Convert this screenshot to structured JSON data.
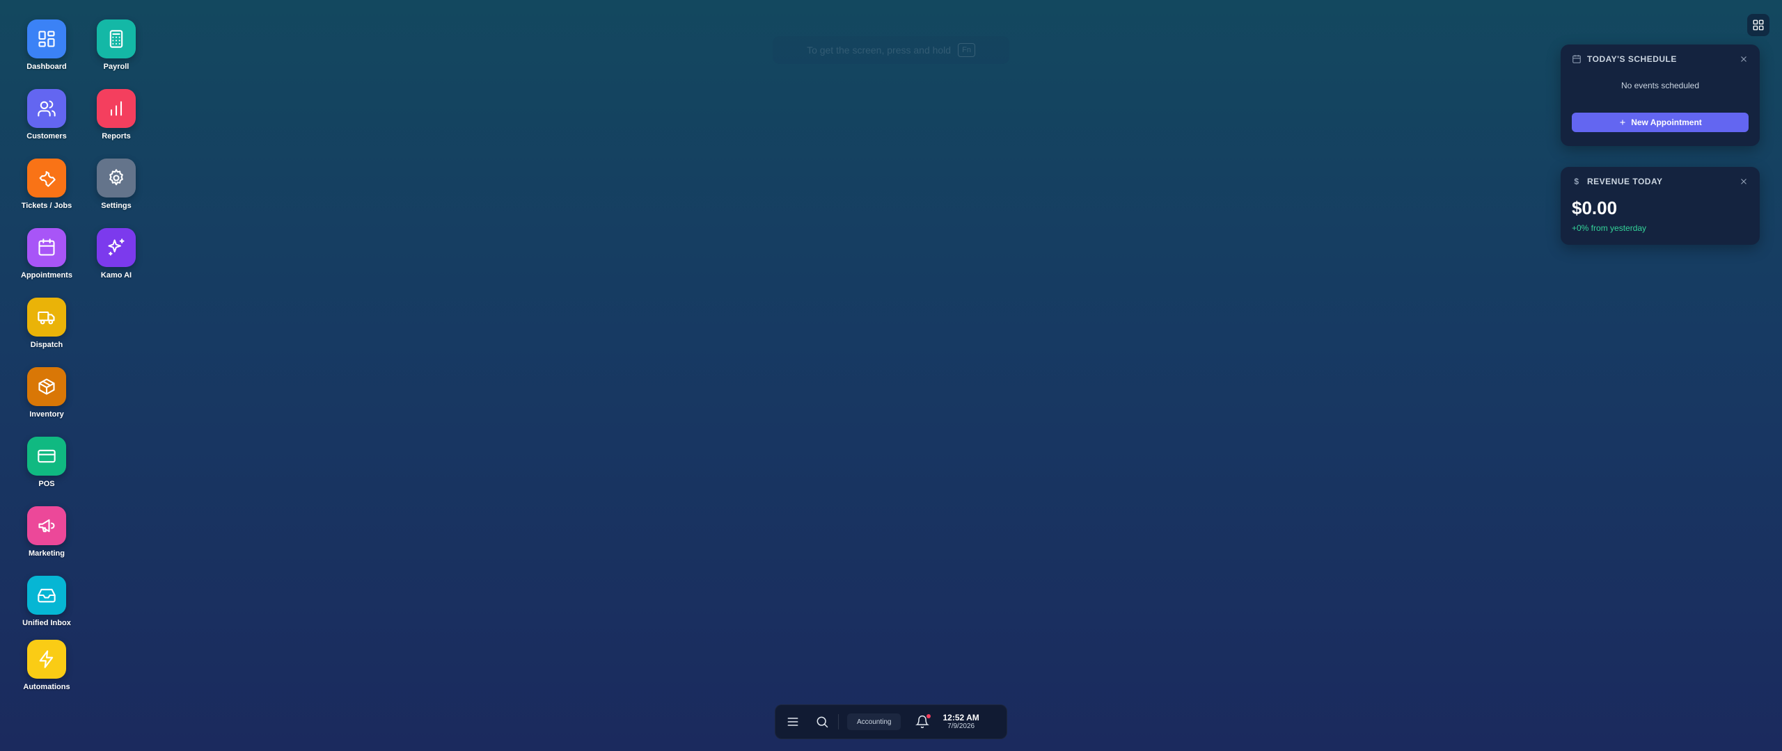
{
  "desktop": {
    "apps": [
      {
        "label": "Dashboard",
        "icon": "dashboard-icon",
        "color": "#3b82f6"
      },
      {
        "label": "Payroll",
        "icon": "calculator-icon",
        "color": "#14b8a6"
      },
      {
        "label": "Customers",
        "icon": "users-icon",
        "color": "#6366f1"
      },
      {
        "label": "Reports",
        "icon": "bar-chart-icon",
        "color": "#f43f5e"
      },
      {
        "label": "Tickets / Jobs",
        "icon": "wrench-icon",
        "color": "#f97316"
      },
      {
        "label": "Settings",
        "icon": "gear-icon",
        "color": "#64748b"
      },
      {
        "label": "Appointments",
        "icon": "calendar-icon",
        "color": "#a855f7"
      },
      {
        "label": "Kamo AI",
        "icon": "sparkles-icon",
        "color": "#7c3aed"
      },
      {
        "label": "Dispatch",
        "icon": "truck-icon",
        "color": "#eab308"
      },
      {
        "label": "Inventory",
        "icon": "box-icon",
        "color": "#d97706"
      },
      {
        "label": "POS",
        "icon": "credit-card-icon",
        "color": "#10b981"
      },
      {
        "label": "Marketing",
        "icon": "megaphone-icon",
        "color": "#ec4899"
      },
      {
        "label": "Unified Inbox",
        "icon": "inbox-icon",
        "color": "#06b6d4"
      },
      {
        "label": "Automations",
        "icon": "lightning-icon",
        "color": "#facc15"
      }
    ]
  },
  "hint": {
    "text": "To get the screen, press and hold",
    "key": "Fn"
  },
  "schedule_widget": {
    "title": "TODAY'S SCHEDULE",
    "empty_text": "No events scheduled",
    "button_label": "New Appointment"
  },
  "revenue_widget": {
    "title": "REVENUE TODAY",
    "value": "$0.00",
    "change": "+0% from yesterday"
  },
  "taskbar": {
    "app_label": "Accounting",
    "time": "12:52 AM",
    "date": "7/9/2026",
    "notification_dot_color": "#f43f5e"
  }
}
